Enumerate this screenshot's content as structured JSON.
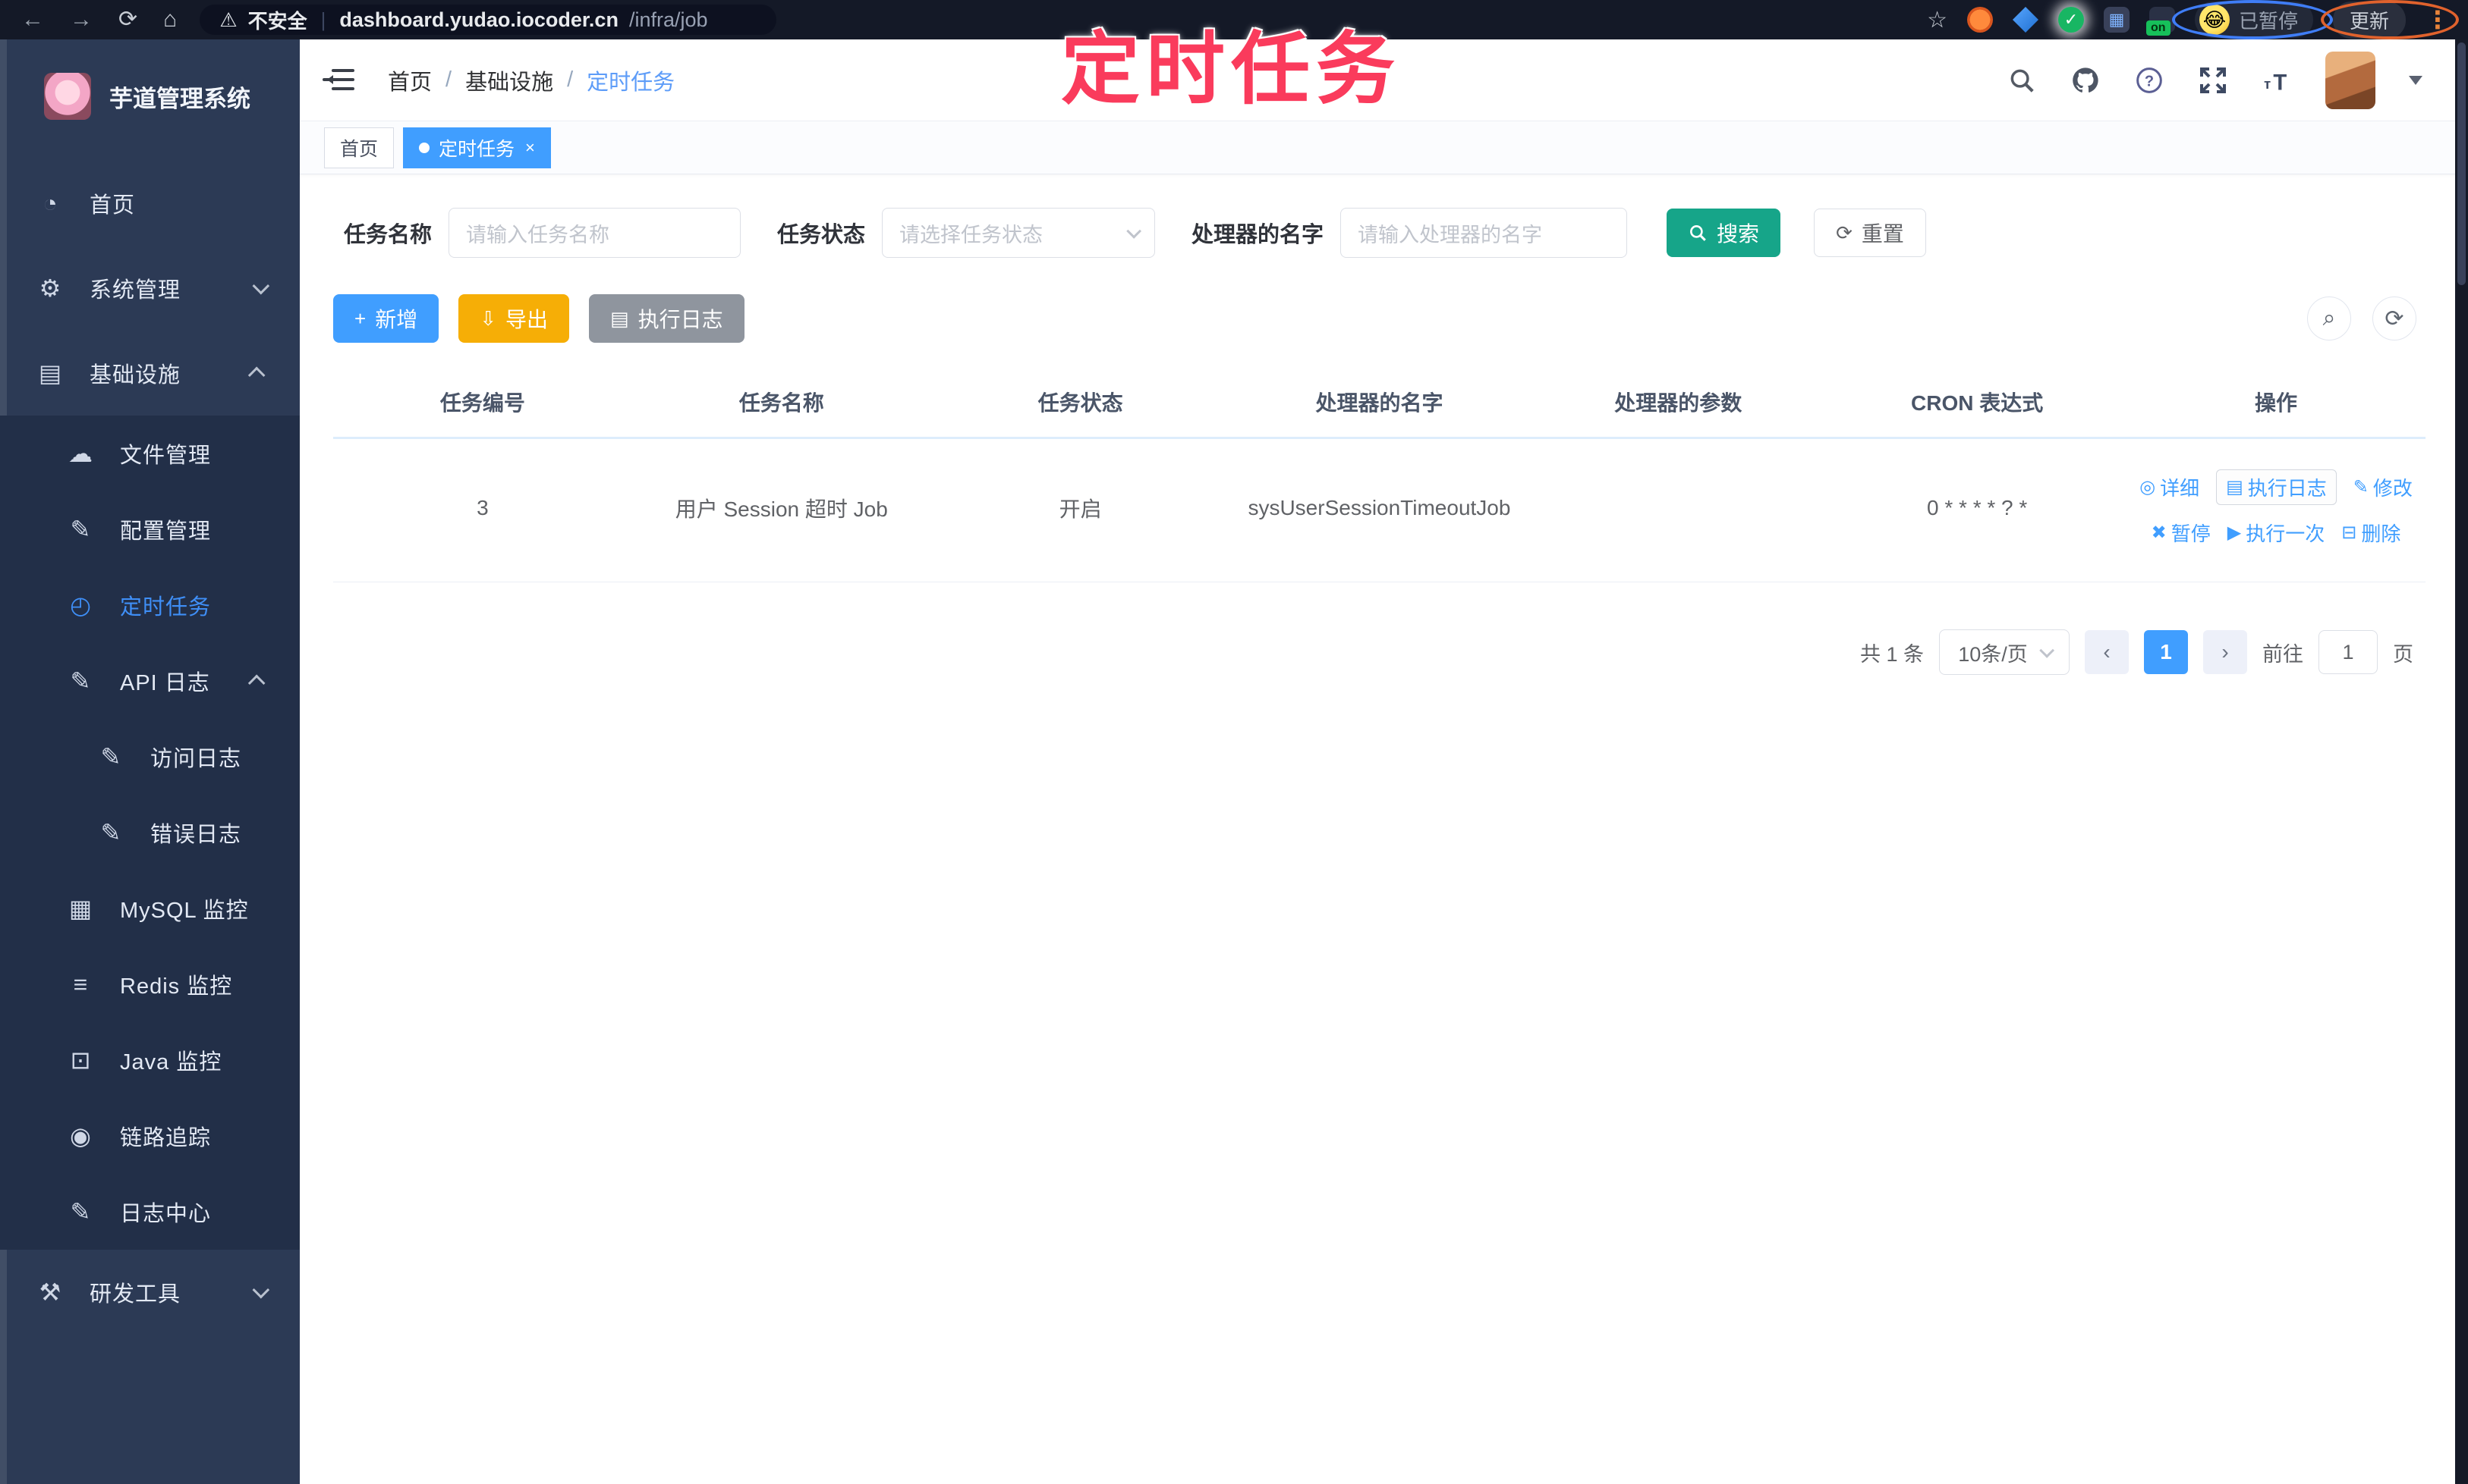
{
  "annotation": {
    "title": "定时任务"
  },
  "browser": {
    "security_warning": "不安全",
    "url_host": "dashboard.yudao.iocoder.cn",
    "url_path": "/infra/job",
    "extension_on_badge": "on",
    "paused_badge": "已暂停",
    "update_button": "更新"
  },
  "sidebar": {
    "app_title": "芋道管理系统",
    "items": [
      {
        "label": "首页",
        "icon": "dashboard",
        "level": 1,
        "dark": false,
        "active": false,
        "arrow": null
      },
      {
        "label": "系统管理",
        "icon": "gear",
        "level": 1,
        "dark": false,
        "active": false,
        "arrow": "down"
      },
      {
        "label": "基础设施",
        "icon": "infra",
        "level": 1,
        "dark": false,
        "active": false,
        "arrow": "up"
      },
      {
        "label": "文件管理",
        "icon": "cloud",
        "level": 2,
        "dark": true,
        "active": false,
        "arrow": null
      },
      {
        "label": "配置管理",
        "icon": "edit",
        "level": 2,
        "dark": true,
        "active": false,
        "arrow": null
      },
      {
        "label": "定时任务",
        "icon": "clock",
        "level": 2,
        "dark": true,
        "active": true,
        "arrow": null
      },
      {
        "label": "API 日志",
        "icon": "log",
        "level": 2,
        "dark": true,
        "active": false,
        "arrow": "up"
      },
      {
        "label": "访问日志",
        "icon": "log",
        "level": 3,
        "dark": true,
        "active": false,
        "arrow": null
      },
      {
        "label": "错误日志",
        "icon": "log",
        "level": 3,
        "dark": true,
        "active": false,
        "arrow": null
      },
      {
        "label": "MySQL 监控",
        "icon": "monitor",
        "level": 2,
        "dark": true,
        "active": false,
        "arrow": null
      },
      {
        "label": "Redis 监控",
        "icon": "layers",
        "level": 2,
        "dark": true,
        "active": false,
        "arrow": null
      },
      {
        "label": "Java 监控",
        "icon": "screen",
        "level": 2,
        "dark": true,
        "active": false,
        "arrow": null
      },
      {
        "label": "链路追踪",
        "icon": "eye",
        "level": 2,
        "dark": true,
        "active": false,
        "arrow": null
      },
      {
        "label": "日志中心",
        "icon": "log",
        "level": 2,
        "dark": true,
        "active": false,
        "arrow": null
      },
      {
        "label": "研发工具",
        "icon": "tools",
        "level": 1,
        "dark": false,
        "active": false,
        "arrow": "down"
      }
    ]
  },
  "header": {
    "breadcrumb": [
      "首页",
      "基础设施",
      "定时任务"
    ]
  },
  "tags": [
    {
      "label": "首页",
      "active": false,
      "closable": false
    },
    {
      "label": "定时任务",
      "active": true,
      "closable": true
    }
  ],
  "filters": {
    "task_name_label": "任务名称",
    "task_name_placeholder": "请输入任务名称",
    "task_status_label": "任务状态",
    "task_status_placeholder": "请选择任务状态",
    "handler_label": "处理器的名字",
    "handler_placeholder": "请输入处理器的名字",
    "search_label": "搜索",
    "reset_label": "重置"
  },
  "toolbar": {
    "add_label": "新增",
    "export_label": "导出",
    "exec_log_label": "执行日志"
  },
  "table": {
    "headers": [
      "任务编号",
      "任务名称",
      "任务状态",
      "处理器的名字",
      "处理器的参数",
      "CRON 表达式",
      "操作"
    ],
    "rows": [
      {
        "id": "3",
        "name": "用户 Session 超时 Job",
        "status": "开启",
        "handler": "sysUserSessionTimeoutJob",
        "param": "",
        "cron": "0 * * * * ? *"
      }
    ],
    "row_actions_line1": [
      {
        "label": "详细",
        "icon": "eye",
        "boxed": false
      },
      {
        "label": "执行日志",
        "icon": "log",
        "boxed": true
      },
      {
        "label": "修改",
        "icon": "edit",
        "boxed": false
      }
    ],
    "row_actions_line2": [
      {
        "label": "暂停",
        "icon": "pause",
        "boxed": false
      },
      {
        "label": "执行一次",
        "icon": "run",
        "boxed": false
      },
      {
        "label": "删除",
        "icon": "delete",
        "boxed": false
      }
    ]
  },
  "pagination": {
    "total_text": "共 1 条",
    "page_size": "10条/页",
    "current_page": "1",
    "goto_label": "前往",
    "goto_value": "1",
    "page_unit": "页"
  },
  "colors": {
    "accent_blue": "#409eff",
    "search_teal": "#16a589",
    "export_amber": "#f6ae06",
    "annotation_red": "#fa3b5c",
    "sidebar_bg": "#2c3a55",
    "submenu_bg": "#222f48"
  }
}
